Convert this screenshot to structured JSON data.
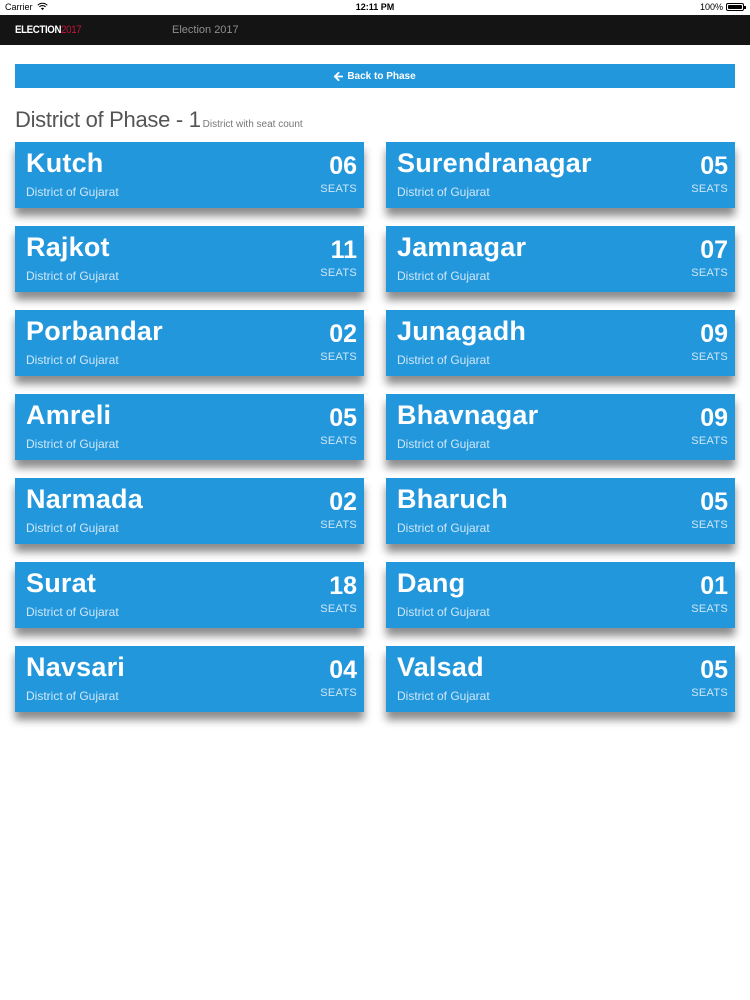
{
  "status_bar": {
    "carrier": "Carrier",
    "time": "12:11 PM",
    "battery": "100%"
  },
  "navbar": {
    "brand_prefix": "ELECTION",
    "brand_year": "2017",
    "link": "Election 2017"
  },
  "back_button": {
    "label": "Back to Phase",
    "icon": "arrow-left-icon"
  },
  "heading": {
    "title": "District of Phase - 1",
    "subtitle": "District with seat count"
  },
  "colors": {
    "card_bg": "#2397dc",
    "navbar_bg": "#141414",
    "brand_accent": "#c3143a"
  },
  "districts": [
    {
      "name": "Kutch",
      "subtitle": "District of Gujarat",
      "seats": "06",
      "unit": "SEATS"
    },
    {
      "name": "Surendranagar",
      "subtitle": "District of Gujarat",
      "seats": "05",
      "unit": "SEATS"
    },
    {
      "name": "Rajkot",
      "subtitle": "District of Gujarat",
      "seats": "11",
      "unit": "SEATS"
    },
    {
      "name": "Jamnagar",
      "subtitle": "District of Gujarat",
      "seats": "07",
      "unit": "SEATS"
    },
    {
      "name": "Porbandar",
      "subtitle": "District of Gujarat",
      "seats": "02",
      "unit": "SEATS"
    },
    {
      "name": "Junagadh",
      "subtitle": "District of Gujarat",
      "seats": "09",
      "unit": "SEATS"
    },
    {
      "name": "Amreli",
      "subtitle": "District of Gujarat",
      "seats": "05",
      "unit": "SEATS"
    },
    {
      "name": "Bhavnagar",
      "subtitle": "District of Gujarat",
      "seats": "09",
      "unit": "SEATS"
    },
    {
      "name": "Narmada",
      "subtitle": "District of Gujarat",
      "seats": "02",
      "unit": "SEATS"
    },
    {
      "name": "Bharuch",
      "subtitle": "District of Gujarat",
      "seats": "05",
      "unit": "SEATS"
    },
    {
      "name": "Surat",
      "subtitle": "District of Gujarat",
      "seats": "18",
      "unit": "SEATS"
    },
    {
      "name": "Dang",
      "subtitle": "District of Gujarat",
      "seats": "01",
      "unit": "SEATS"
    },
    {
      "name": "Navsari",
      "subtitle": "District of Gujarat",
      "seats": "04",
      "unit": "SEATS"
    },
    {
      "name": "Valsad",
      "subtitle": "District of Gujarat",
      "seats": "05",
      "unit": "SEATS"
    }
  ]
}
